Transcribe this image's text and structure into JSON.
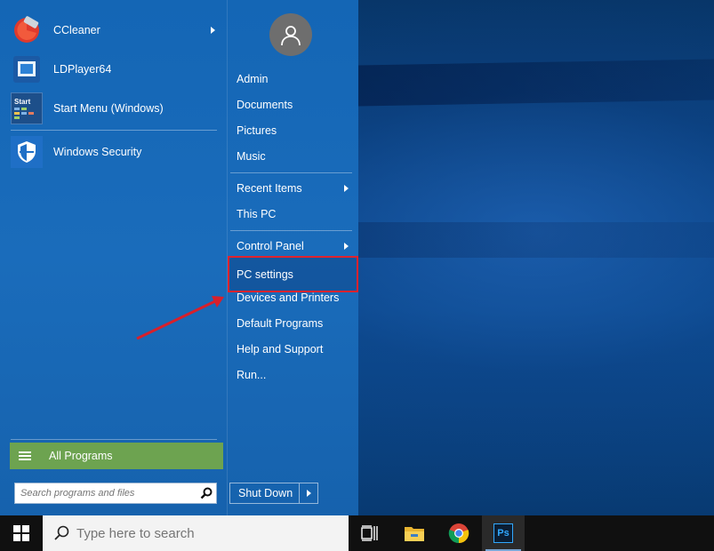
{
  "programs": [
    {
      "label": "CCleaner",
      "icon": "ccleaner-icon",
      "has_submenu": true
    },
    {
      "label": "LDPlayer64",
      "icon": "ldplayer-icon",
      "has_submenu": false
    },
    {
      "label": "Start Menu (Windows)",
      "icon": "start-menu-icon",
      "has_submenu": false,
      "icon_text": "Start"
    },
    {
      "label": "Windows Security",
      "icon": "shield-icon",
      "has_submenu": false
    }
  ],
  "all_programs": {
    "label": "All Programs"
  },
  "search": {
    "placeholder": "Search programs and files"
  },
  "right_items": [
    {
      "label": "Admin"
    },
    {
      "label": "Documents"
    },
    {
      "label": "Pictures"
    },
    {
      "label": "Music"
    },
    {
      "label": "Recent Items",
      "has_submenu": true
    },
    {
      "label": "This PC"
    },
    {
      "label": "Control Panel",
      "has_submenu": true
    },
    {
      "label": "PC settings",
      "highlighted": true
    },
    {
      "label": "Devices and Printers"
    },
    {
      "label": "Default Programs"
    },
    {
      "label": "Help and Support"
    },
    {
      "label": "Run..."
    }
  ],
  "shutdown": {
    "label": "Shut Down"
  },
  "taskbar": {
    "search_placeholder": "Type here to search",
    "pinned": [
      {
        "icon": "task-view-icon"
      },
      {
        "icon": "file-explorer-icon"
      },
      {
        "icon": "chrome-icon"
      },
      {
        "icon": "photoshop-icon",
        "icon_text": "Ps",
        "active": true
      }
    ]
  },
  "colors": {
    "menu_bg": "#1a6cbb",
    "all_programs_bg": "#6da350",
    "highlight_border": "#e0232e",
    "annotation_arrow": "#d8202b",
    "taskbar_bg": "#101010"
  }
}
